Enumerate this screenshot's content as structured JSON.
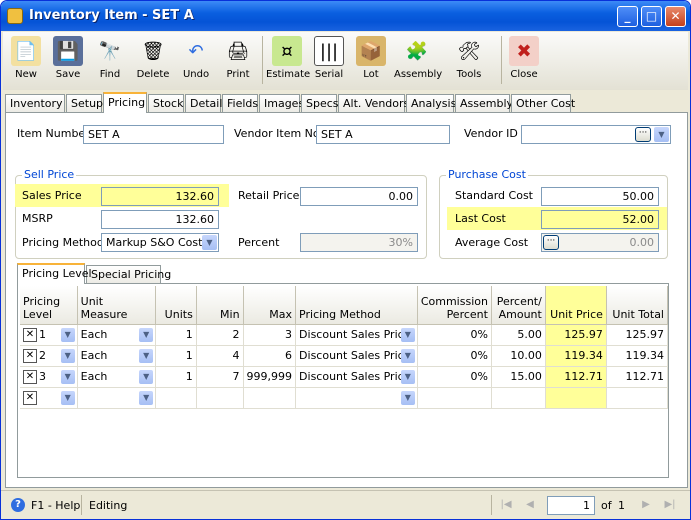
{
  "window": {
    "title": "Inventory Item - SET A"
  },
  "toolbar": {
    "new": "New",
    "save": "Save",
    "find": "Find",
    "delete": "Delete",
    "undo": "Undo",
    "print": "Print",
    "estimate": "Estimate",
    "serial": "Serial",
    "lot": "Lot",
    "assembly": "Assembly",
    "tools": "Tools",
    "close": "Close"
  },
  "tabs": [
    "Inventory",
    "Setup",
    "Pricing",
    "Stock",
    "Detail",
    "Fields",
    "Images",
    "Specs",
    "Alt. Vendors",
    "Analysis",
    "Assembly",
    "Other Cost"
  ],
  "header": {
    "item_number_label": "Item Number",
    "item_number": "SET A",
    "vendor_item_label": "Vendor Item No",
    "vendor_item": "SET A",
    "vendor_id_label": "Vendor ID",
    "vendor_id": ""
  },
  "sell_price": {
    "group_title": "Sell Price",
    "sales_price_label": "Sales Price",
    "sales_price": "132.60",
    "msrp_label": "MSRP",
    "msrp": "132.60",
    "pricing_method_label": "Pricing Method",
    "pricing_method": "Markup S&O Cost",
    "retail_price_label": "Retail Price",
    "retail_price": "0.00",
    "percent_label": "Percent",
    "percent": "30%"
  },
  "purchase_cost": {
    "group_title": "Purchase Cost",
    "standard_cost_label": "Standard Cost",
    "standard_cost": "50.00",
    "last_cost_label": "Last Cost",
    "last_cost": "52.00",
    "average_cost_label": "Average Cost",
    "average_cost": "0.00"
  },
  "subtabs": [
    "Pricing Level",
    "Special Pricing"
  ],
  "grid": {
    "headers": {
      "pricing_level": "Pricing Level",
      "unit_measure": "Unit Measure",
      "units": "Units",
      "min": "Min",
      "max": "Max",
      "pricing_method": "Pricing Method",
      "commission": "Commission Percent",
      "percent_amount": "Percent/ Amount",
      "unit_price": "Unit Price",
      "unit_total": "Unit Total"
    },
    "rows": [
      {
        "level": "1",
        "uom": "Each",
        "units": "1",
        "min": "2",
        "max": "3",
        "method": "Discount Sales Price",
        "commission": "0%",
        "pct": "5.00",
        "unit_price": "125.97",
        "unit_total": "125.97"
      },
      {
        "level": "2",
        "uom": "Each",
        "units": "1",
        "min": "4",
        "max": "6",
        "method": "Discount Sales Price",
        "commission": "0%",
        "pct": "10.00",
        "unit_price": "119.34",
        "unit_total": "119.34"
      },
      {
        "level": "3",
        "uom": "Each",
        "units": "1",
        "min": "7",
        "max": "999,999",
        "method": "Discount Sales Price",
        "commission": "0%",
        "pct": "15.00",
        "unit_price": "112.71",
        "unit_total": "112.71"
      }
    ]
  },
  "status": {
    "help": "F1 - Help",
    "mode": "Editing",
    "page": "1",
    "of": "of",
    "total": "1"
  },
  "colors": {
    "highlight": "#ffff99",
    "accent": "#0046d5",
    "titlebar": "#0a5fe0"
  }
}
